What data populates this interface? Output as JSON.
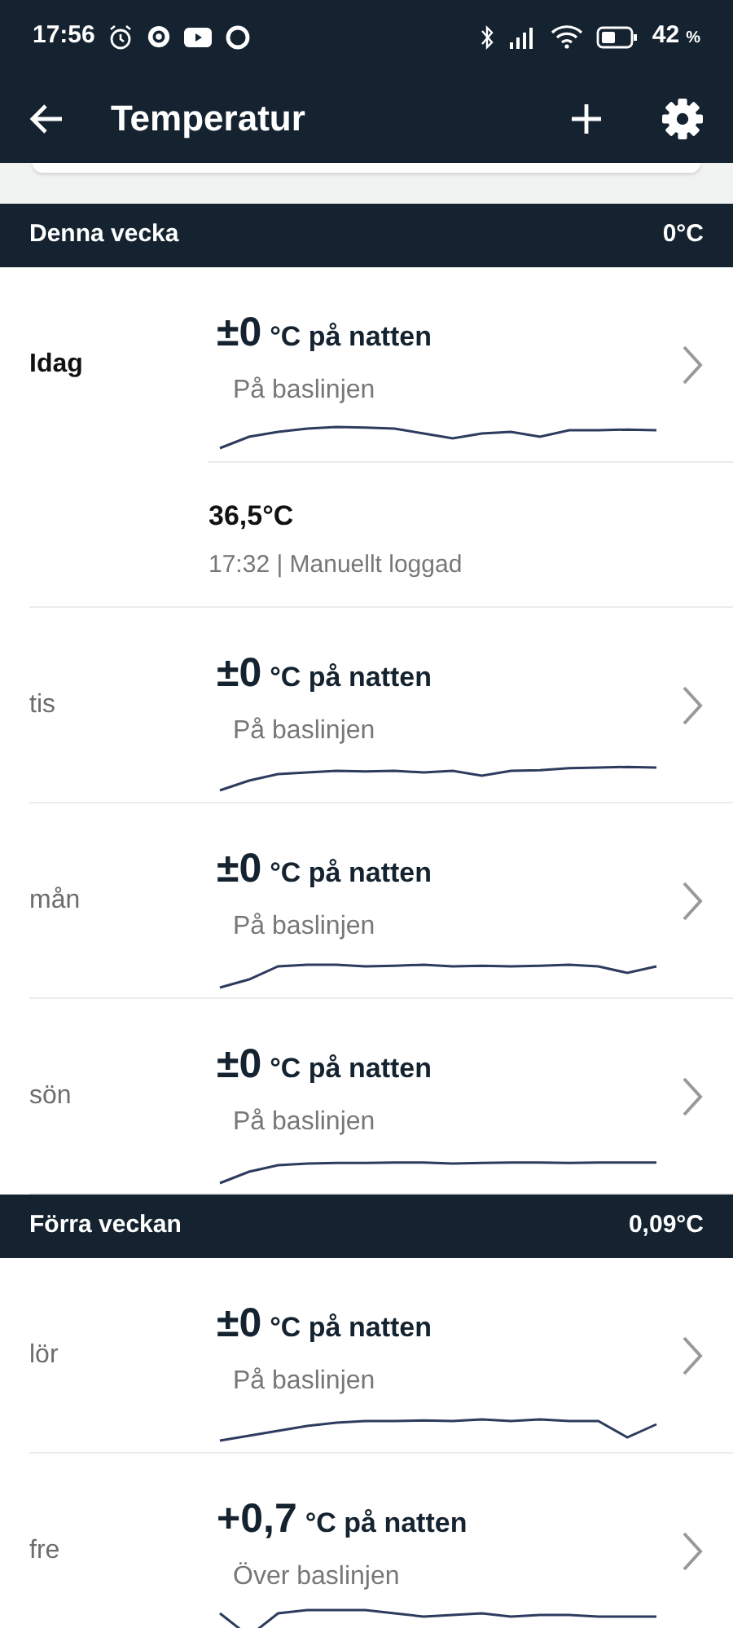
{
  "status_bar": {
    "time": "17:56",
    "battery": "42",
    "battery_unit": "%"
  },
  "app_bar": {
    "title": "Temperatur"
  },
  "sections": [
    {
      "title": "Denna vecka",
      "value": "0°C",
      "days": [
        {
          "day": "Idag",
          "today": true,
          "value": "±0",
          "unit": "°C på natten",
          "status": "På baslinjen",
          "entries": [
            {
              "value": "36,5°C",
              "detail": "17:32 | Manuellt loggad"
            }
          ]
        },
        {
          "day": "tis",
          "today": false,
          "value": "±0",
          "unit": "°C på natten",
          "status": "På baslinjen"
        },
        {
          "day": "mån",
          "today": false,
          "value": "±0",
          "unit": "°C på natten",
          "status": "På baslinjen"
        },
        {
          "day": "sön",
          "today": false,
          "value": "±0",
          "unit": "°C på natten",
          "status": "På baslinjen"
        }
      ]
    },
    {
      "title": "Förra veckan",
      "value": "0,09°C",
      "days": [
        {
          "day": "lör",
          "today": false,
          "value": "±0",
          "unit": "°C på natten",
          "status": "På baslinjen"
        },
        {
          "day": "fre",
          "today": false,
          "value": "+0,7",
          "unit": "°C på natten",
          "status": "Över baslinjen"
        }
      ]
    }
  ]
}
